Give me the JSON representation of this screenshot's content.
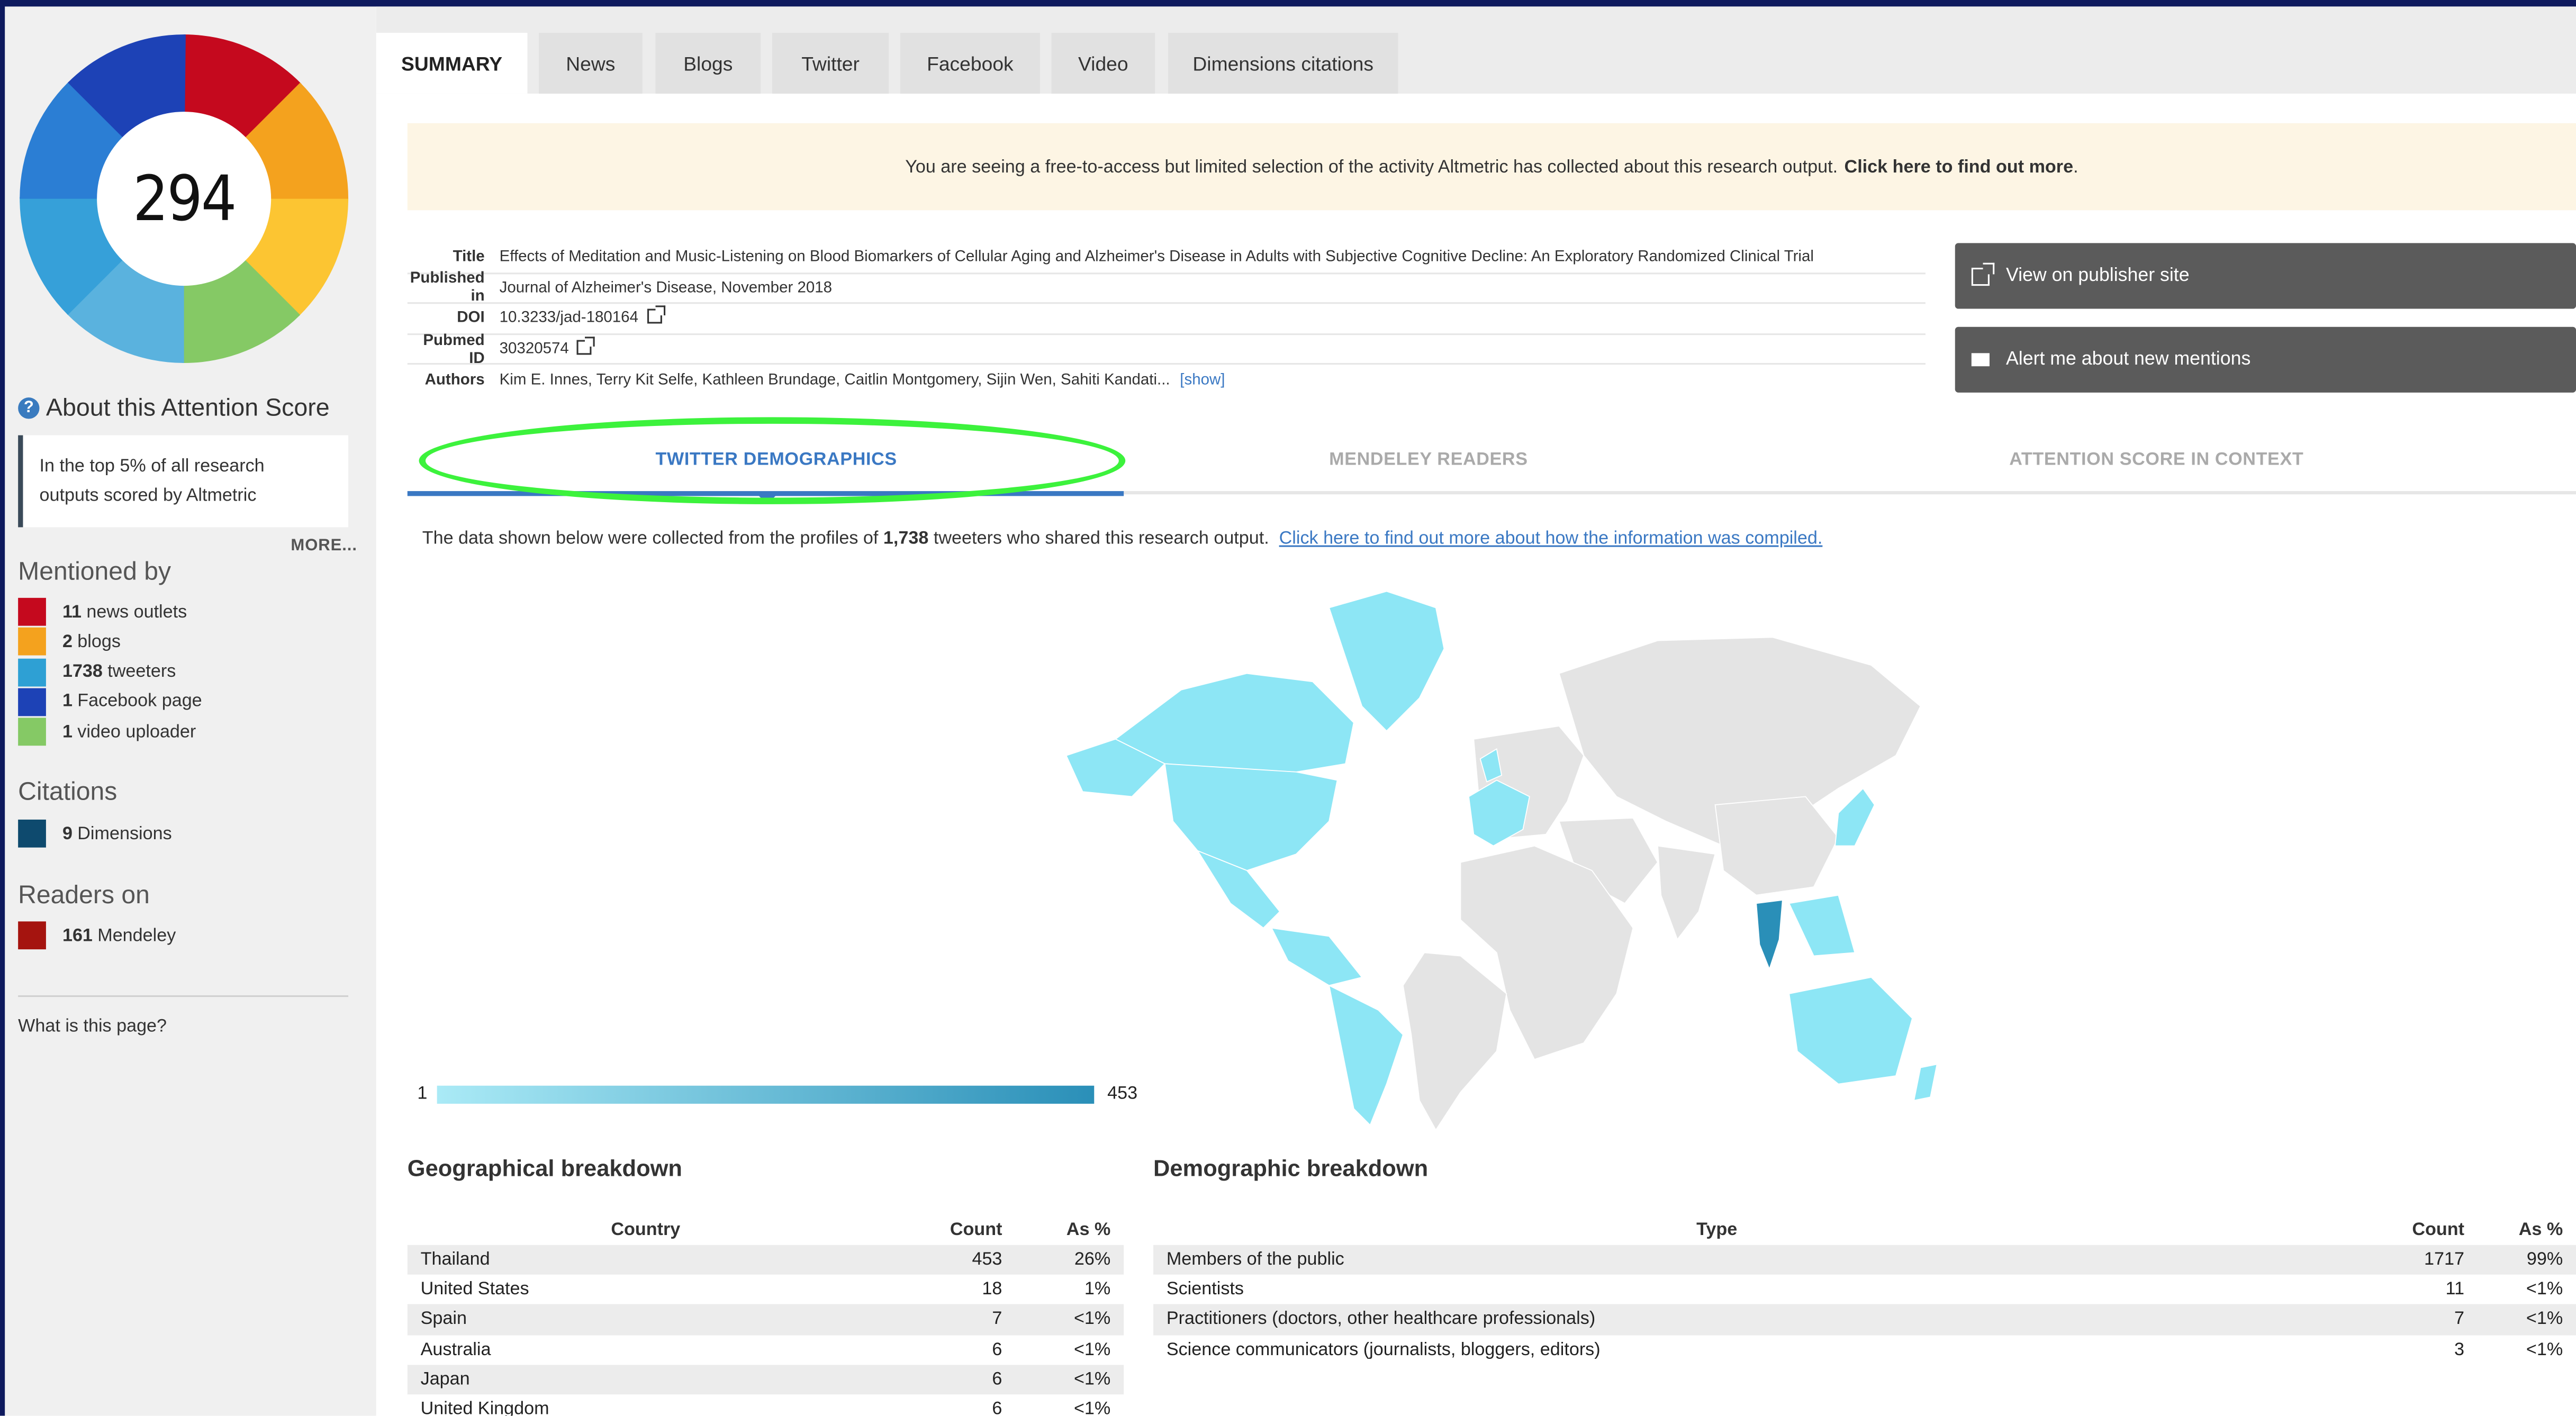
{
  "sidebar": {
    "score": "294",
    "donut_colors": [
      "#c5091e",
      "#f4a21e",
      "#fcc532",
      "#85c965",
      "#5ab2de",
      "#36a0d9",
      "#2b7ed4",
      "#1d42b6"
    ],
    "about_title": "About this Attention Score",
    "top_text_line1": "In the top 5% of all research",
    "top_text_line2": "outputs scored by Altmetric",
    "more_label": "MORE...",
    "mentioned_title": "Mentioned by",
    "mentioned": [
      {
        "count": "11",
        "label": "news outlets",
        "color": "#c5091e"
      },
      {
        "count": "2",
        "label": "blogs",
        "color": "#f4a21e"
      },
      {
        "count": "1738",
        "label": "tweeters",
        "color": "#2ea0d4"
      },
      {
        "count": "1",
        "label": "Facebook page",
        "color": "#1d42b6"
      },
      {
        "count": "1",
        "label": "video uploader",
        "color": "#85c965"
      }
    ],
    "citations_title": "Citations",
    "citations": [
      {
        "count": "9",
        "label": "Dimensions",
        "color": "#0e4a6e"
      }
    ],
    "readers_title": "Readers on",
    "readers": [
      {
        "count": "161",
        "label": "Mendeley",
        "color": "#a5140f"
      }
    ],
    "whatis": "What is this page?"
  },
  "tabs": [
    "SUMMARY",
    "News",
    "Blogs",
    "Twitter",
    "Facebook",
    "Video",
    "Dimensions citations"
  ],
  "notice": {
    "text": "You are seeing a free-to-access but limited selection of the activity Altmetric has collected about this research output.",
    "link": "Click here to find out more",
    "end": "."
  },
  "meta": [
    {
      "label": "Title",
      "value": "Effects of Meditation and Music-Listening on Blood Biomarkers of Cellular Aging and Alzheimer's Disease in Adults with Subjective Cognitive Decline: An Exploratory Randomized Clinical Trial"
    },
    {
      "label": "Published in",
      "value": "Journal of Alzheimer's Disease, November 2018"
    },
    {
      "label": "DOI",
      "value": "10.3233/jad-180164"
    },
    {
      "label": "Pubmed ID",
      "value": "30320574"
    },
    {
      "label": "Authors",
      "value": "Kim E. Innes, Terry Kit Selfe, Kathleen Brundage, Caitlin Montgomery, Sijin Wen, Sahiti Kandati...",
      "show": "[show]"
    }
  ],
  "buttons": {
    "publisher": "View on publisher site",
    "alert": "Alert me about new mentions"
  },
  "subtabs": [
    "TWITTER DEMOGRAPHICS",
    "MENDELEY READERS",
    "ATTENTION SCORE IN CONTEXT"
  ],
  "intro": {
    "pre": "The data shown below were collected from the profiles of",
    "count": "1,738",
    "post": "tweeters who shared this research output.",
    "link": "Click here to find out more about how the information was compiled."
  },
  "map_scale": {
    "min": "1",
    "max": "453"
  },
  "geo": {
    "title": "Geographical breakdown",
    "headers": [
      "Country",
      "Count",
      "As %"
    ],
    "rows": [
      [
        "Thailand",
        "453",
        "26%"
      ],
      [
        "United States",
        "18",
        "1%"
      ],
      [
        "Spain",
        "7",
        "<1%"
      ],
      [
        "Australia",
        "6",
        "<1%"
      ],
      [
        "Japan",
        "6",
        "<1%"
      ],
      [
        "United Kingdom",
        "6",
        "<1%"
      ]
    ]
  },
  "demo": {
    "title": "Demographic breakdown",
    "headers": [
      "Type",
      "Count",
      "As %"
    ],
    "rows": [
      [
        "Members of the public",
        "1717",
        "99%"
      ],
      [
        "Scientists",
        "11",
        "<1%"
      ],
      [
        "Practitioners (doctors, other healthcare professionals)",
        "7",
        "<1%"
      ],
      [
        "Science communicators (journalists, bloggers, editors)",
        "3",
        "<1%"
      ]
    ]
  }
}
